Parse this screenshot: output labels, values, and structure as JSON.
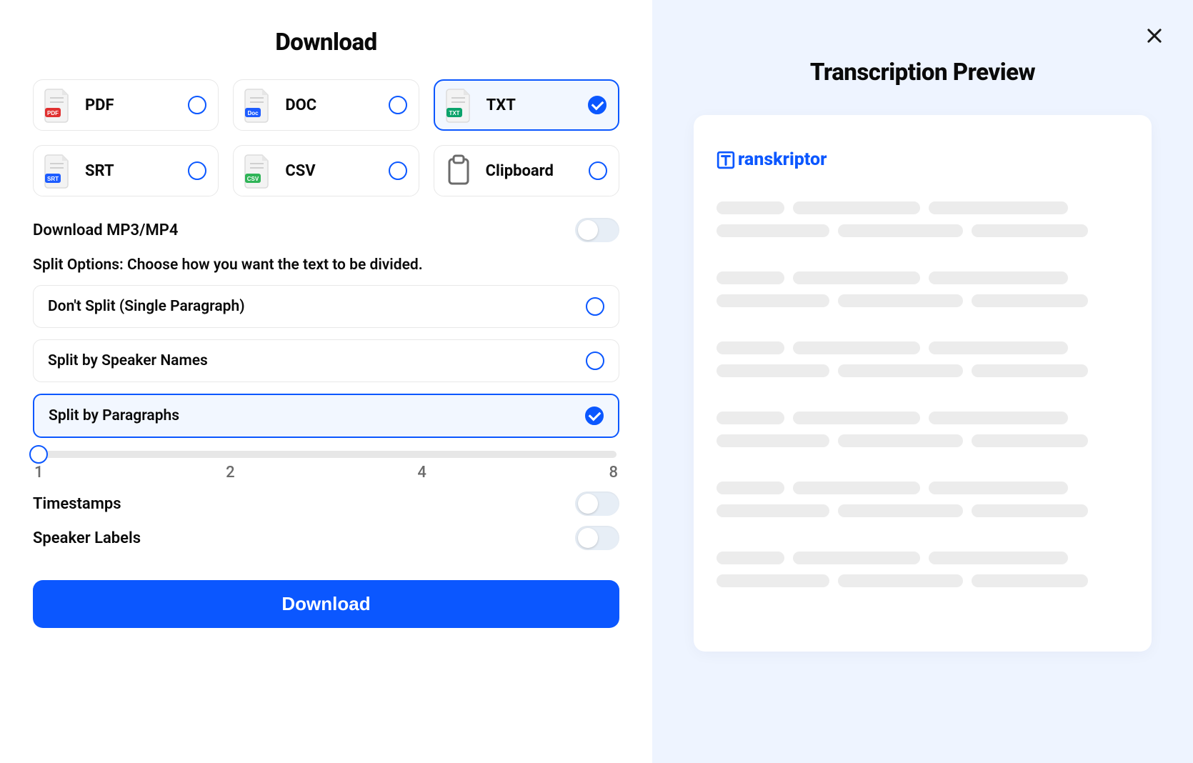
{
  "left": {
    "title": "Download",
    "formats": [
      {
        "id": "pdf",
        "label": "PDF",
        "tag": "PDF",
        "tag_bg": "#e03030",
        "selected": false
      },
      {
        "id": "doc",
        "label": "DOC",
        "tag": "Doc",
        "tag_bg": "#1d5cff",
        "selected": false
      },
      {
        "id": "txt",
        "label": "TXT",
        "tag": "TXT",
        "tag_bg": "#0ba36b",
        "selected": true
      },
      {
        "id": "srt",
        "label": "SRT",
        "tag": "SRT",
        "tag_bg": "#1d5cff",
        "selected": false
      },
      {
        "id": "csv",
        "label": "CSV",
        "tag": "CSV",
        "tag_bg": "#2fb457",
        "selected": false
      },
      {
        "id": "clip",
        "label": "Clipboard",
        "tag": "",
        "tag_bg": "",
        "selected": false,
        "clipboard": true
      }
    ],
    "mp3_toggle": {
      "label": "Download MP3/MP4",
      "on": false
    },
    "split_header": "Split Options: Choose how you want the text to be divided.",
    "split_options": [
      {
        "id": "no-split",
        "label": "Don't Split (Single Paragraph)",
        "selected": false
      },
      {
        "id": "split-speaker",
        "label": "Split by Speaker Names",
        "selected": false
      },
      {
        "id": "split-para",
        "label": "Split by Paragraphs",
        "selected": true
      }
    ],
    "slider": {
      "value": 1,
      "ticks": [
        "1",
        "2",
        "4",
        "8"
      ]
    },
    "toggles": [
      {
        "id": "timestamps",
        "label": "Timestamps",
        "on": false
      },
      {
        "id": "speaker-labels",
        "label": "Speaker Labels",
        "on": false
      }
    ],
    "download_button": "Download"
  },
  "right": {
    "title": "Transcription Preview",
    "brand": "ranskriptor",
    "brand_initial": "T"
  },
  "colors": {
    "accent": "#0b57ff",
    "preview_bg": "#eef4ff",
    "skeleton": "#ececec"
  }
}
